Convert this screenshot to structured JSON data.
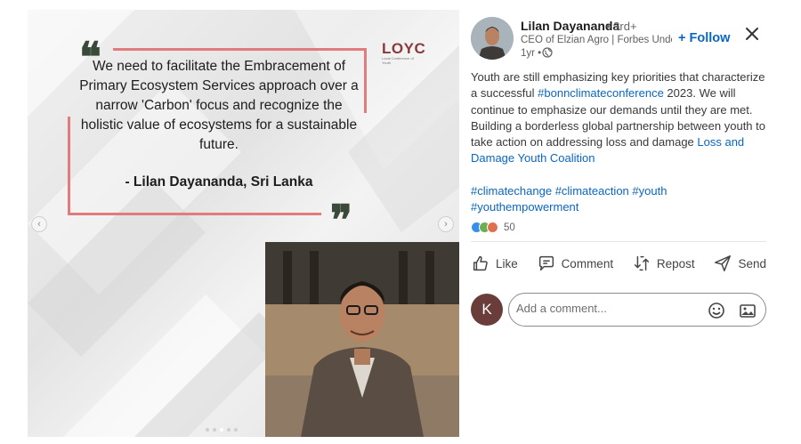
{
  "post": {
    "quote_text": "We need to facilitate the Embracement of Primary Ecosystem Services approach over a narrow 'Carbon' focus and recognize the holistic value of ecosystems for a sustainable future.",
    "quote_author": "-  Lilan Dayananda, Sri Lanka",
    "logo_text": "LOYC",
    "logo_sub": "Local Conference of Youth"
  },
  "author": {
    "name": "Lilan Dayananda",
    "degree": "• 3rd+",
    "headline": "CEO of Elzian Agro | Forbes Unde...",
    "time": "1yr •",
    "follow_label": "+ Follow"
  },
  "body": {
    "text1": "Youth are still emphasizing key priorities that characterize a successful ",
    "link1": "#bonnclimateconference",
    "text2": " 2023. We will continue to emphasize our demands until they are met. Building a borderless global partnership between youth to take action on addressing loss and damage ",
    "link2": "Loss and Damage Youth Coalition"
  },
  "tags": [
    "#climatechange",
    "#climateaction",
    "#youth",
    "#youthempowerment"
  ],
  "reactions": {
    "count": "50"
  },
  "actions": {
    "like": "Like",
    "comment": "Comment",
    "repost": "Repost",
    "send": "Send"
  },
  "comment": {
    "avatar_initial": "K",
    "placeholder": "Add a comment..."
  },
  "icons": {
    "close": "close-icon",
    "globe": "globe-icon",
    "like": "thumbs-up-icon",
    "comment": "comment-bubble-icon",
    "repost": "repost-arrows-icon",
    "send": "paper-plane-icon",
    "emoji": "smiley-icon",
    "image": "image-icon"
  },
  "colors": {
    "accent": "#0a66c2",
    "quote_frame": "#e27b7b"
  }
}
